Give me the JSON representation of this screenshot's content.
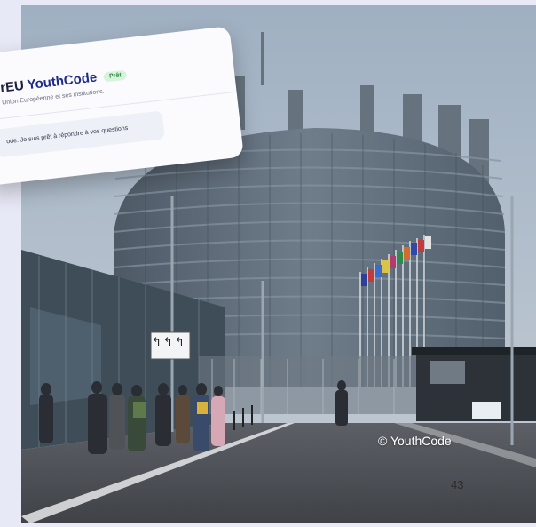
{
  "app_card": {
    "title_prefix": "rEU ",
    "title_brand": "YouthCode",
    "status_badge": "Prêt",
    "subtitle": "Union Européenne et ses institutions.",
    "message": "ode. Je suis prêt à répondre à vos questions"
  },
  "photo": {
    "credit": "© YouthCode",
    "sign_arrows": [
      "↰",
      "↰",
      "↰"
    ]
  },
  "page": {
    "number": "43"
  },
  "colors": {
    "sky": "#a9b6c6",
    "building": "#5e6b78",
    "ground": "#4b4f55",
    "brand": "#1d2c8a",
    "badge_bg": "#d7f3dc"
  }
}
